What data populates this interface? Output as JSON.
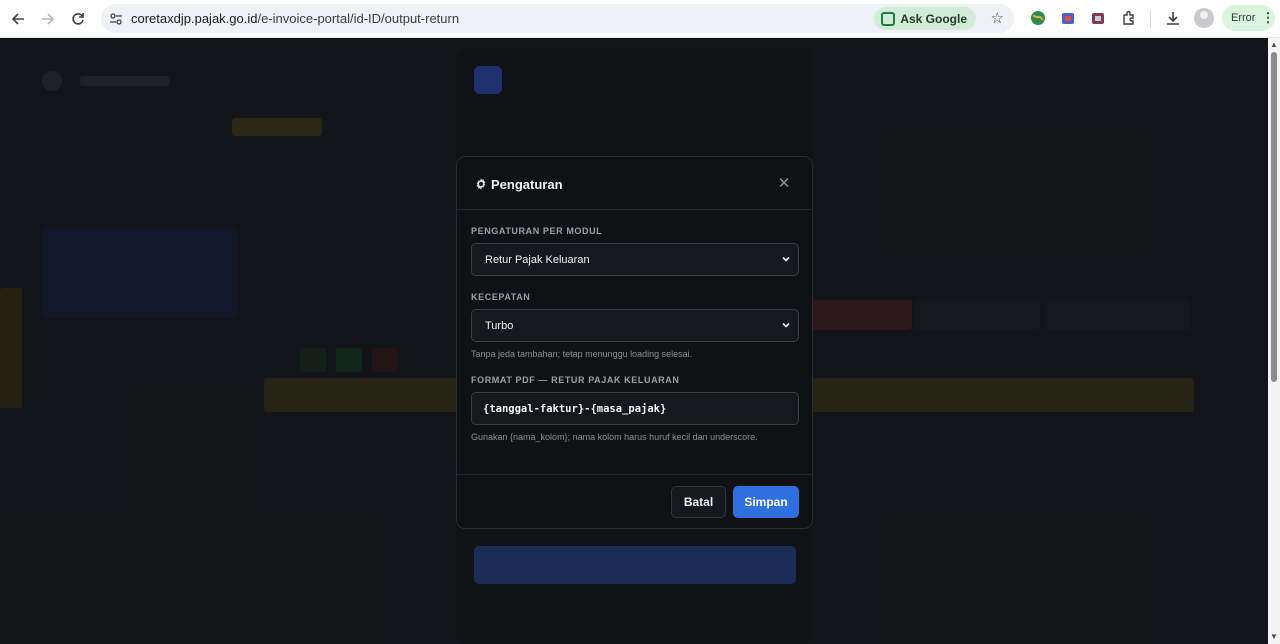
{
  "browser": {
    "url_host": "coretaxdjp.pajak.go.id",
    "url_path": "/e-invoice-portal/id-ID/output-return",
    "ask_google_label": "Ask Google",
    "error_label": "Error"
  },
  "modal": {
    "title": "Pengaturan",
    "module_label": "PENGATURAN PER MODUL",
    "module_value": "Retur Pajak Keluaran",
    "speed_label": "KECEPATAN",
    "speed_value": "Turbo",
    "speed_hint": "Tanpa jeda tambahan; tetap menunggu loading selesai.",
    "format_label": "FORMAT PDF — RETUR PAJAK KELUARAN",
    "format_value": "{tanggal-faktur}-{masa_pajak}",
    "format_hint": "Gunakan {nama_kolom}; nama kolom harus huruf kecil dan underscore.",
    "cancel_label": "Batal",
    "save_label": "Simpan"
  },
  "colors": {
    "accent": "#2f6fe0",
    "modal_bg": "#0f1115",
    "ask_google_bg": "#d3ecd8"
  }
}
